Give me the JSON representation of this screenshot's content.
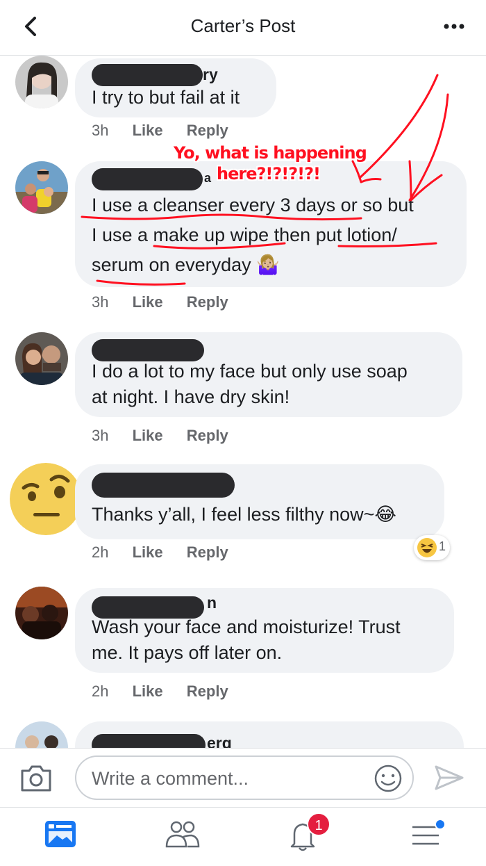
{
  "header": {
    "title": "Carter’s Post"
  },
  "comments": [
    {
      "name_suffix": "ry",
      "text": "I try to but fail at it",
      "time": "3h",
      "like": "Like",
      "reply": "Reply"
    },
    {
      "name_suffix": "a",
      "text": "I use a cleanser every 3 days or so but\nI use a make up wipe then put lotion/\nserum on everyday 🤷🏼‍♀️",
      "time": "3h",
      "like": "Like",
      "reply": "Reply"
    },
    {
      "name_suffix": "",
      "text": "I do a lot to my face but only use soap\nat night. I have dry skin!",
      "time": "3h",
      "like": "Like",
      "reply": "Reply"
    },
    {
      "name_suffix": "",
      "text": "Thanks y’all, I feel less filthy now~😂",
      "time": "2h",
      "like": "Like",
      "reply": "Reply",
      "reaction_count": "1"
    },
    {
      "name_suffix": "n",
      "text": "Wash your face and moisturize! Trust\nme. It pays off later on.",
      "time": "2h",
      "like": "Like",
      "reply": "Reply"
    },
    {
      "name_suffix": "erg"
    }
  ],
  "annotation": {
    "line1": "Yo, what is happening",
    "line2": "here?!?!?!?!",
    "color": "#ff1020"
  },
  "composer": {
    "placeholder": "Write a comment..."
  },
  "nav": {
    "notifications_badge": "1"
  },
  "colors": {
    "bubble": "#f0f2f5",
    "secondary_text": "#65676b",
    "badge": "#e41e3f",
    "accent": "#1877f2"
  }
}
